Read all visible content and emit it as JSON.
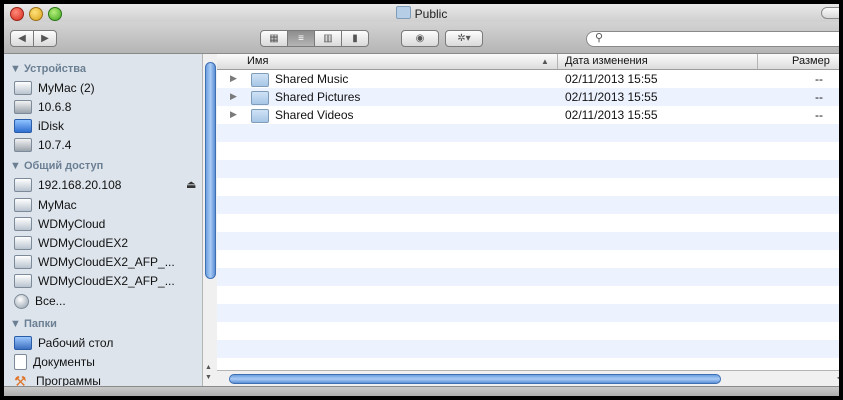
{
  "window": {
    "title": "Public"
  },
  "toolbar": {
    "back_glyph": "◀",
    "forward_glyph": "▶",
    "view_icons_glyph": "▦",
    "view_list_glyph": "≡",
    "view_columns_glyph": "▥",
    "view_coverflow_glyph": "▮",
    "quicklook_glyph": "◉",
    "action_glyph": "✲▾",
    "search_glyph": "⚲",
    "search_value": ""
  },
  "sidebar": {
    "devices_label": "▼ Устройства",
    "devices": [
      {
        "label": "MyMac (2)",
        "icon": "computer-icon"
      },
      {
        "label": "10.6.8",
        "icon": "disk-icon"
      },
      {
        "label": "iDisk",
        "icon": "idisk-icon"
      },
      {
        "label": "10.7.4",
        "icon": "disk-icon"
      }
    ],
    "shared_label": "▼ Общий доступ",
    "shared": [
      {
        "label": "192.168.20.108",
        "icon": "computer-icon"
      },
      {
        "label": "MyMac",
        "icon": "computer-icon"
      },
      {
        "label": "WDMyCloud",
        "icon": "computer-icon"
      },
      {
        "label": "WDMyCloudEX2",
        "icon": "computer-icon"
      },
      {
        "label": "WDMyCloudEX2_AFP_...",
        "icon": "computer-icon"
      },
      {
        "label": "WDMyCloudEX2_AFP_...",
        "icon": "computer-icon"
      },
      {
        "label": "Все...",
        "icon": "globe-icon"
      }
    ],
    "eject_glyph": "⏏",
    "places_label": "▼ Папки",
    "places": [
      {
        "label": "Рабочий стол",
        "icon": "desktop-icon"
      },
      {
        "label": "Документы",
        "icon": "documents-icon"
      },
      {
        "label": "Программы",
        "icon": "applications-icon"
      }
    ]
  },
  "list": {
    "columns": {
      "name": "Имя",
      "sort_indicator": "▲",
      "date": "Дата изменения",
      "size": "Размер"
    },
    "rows": [
      {
        "name": "Shared Music",
        "date": "02/11/2013 15:55",
        "size": "--"
      },
      {
        "name": "Shared Pictures",
        "date": "02/11/2013 15:55",
        "size": "--"
      },
      {
        "name": "Shared Videos",
        "date": "02/11/2013 15:55",
        "size": "--"
      }
    ],
    "disclosure_glyph": "▶"
  },
  "scrollbars": {
    "up_glyph": "▲",
    "down_glyph": "▼",
    "left_glyph": "◀"
  }
}
